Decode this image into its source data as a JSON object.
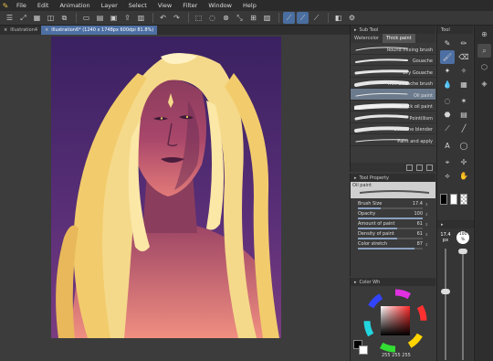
{
  "menu": {
    "items": [
      "File",
      "Edit",
      "Animation",
      "Layer",
      "Select",
      "View",
      "Filter",
      "Window",
      "Help"
    ]
  },
  "tabs": [
    {
      "label": "Illustration4",
      "active": false
    },
    {
      "label": "Illustration6* (1240 x 1748px 600dpi 81.8%)",
      "active": true
    }
  ],
  "subtool": {
    "header": "Sub Tool",
    "tabs": [
      "Watercolor",
      "Thick paint"
    ],
    "brushes": [
      {
        "name": "Round mixing brush",
        "selected": false
      },
      {
        "name": "Gouache",
        "selected": false
      },
      {
        "name": "Dry Gouache",
        "selected": false
      },
      {
        "name": "Thin Gouache brush",
        "selected": false
      },
      {
        "name": "Oil paint",
        "selected": true
      },
      {
        "name": "Thick oil paint",
        "selected": false
      },
      {
        "name": "Pointillism",
        "selected": false
      },
      {
        "name": "Gouache blender",
        "selected": false
      },
      {
        "name": "Paint and apply",
        "selected": false
      }
    ]
  },
  "toolprop": {
    "header": "Tool Property",
    "preview_label": "Oil paint",
    "props": [
      {
        "label": "Brush Size",
        "value": "17.4",
        "fill": 0.35
      },
      {
        "label": "Opacity",
        "value": "100",
        "fill": 1.0
      },
      {
        "label": "Amount of paint",
        "value": "61",
        "fill": 0.61
      },
      {
        "label": "Density of paint",
        "value": "61",
        "fill": 0.61
      },
      {
        "label": "Color stretch",
        "value": "87",
        "fill": 0.87
      }
    ]
  },
  "colorpanel": {
    "header": "Color Wh",
    "values": "255 255 255"
  },
  "tool_strip": {
    "header": "Tool",
    "size_value": "17.4",
    "size_unit": "px",
    "opacity_value": "100",
    "opacity_unit": "%"
  },
  "colors": {
    "accent": "#4d6fa3",
    "hair": "#f5d98a",
    "bg_purple": "#4a2a6a"
  }
}
